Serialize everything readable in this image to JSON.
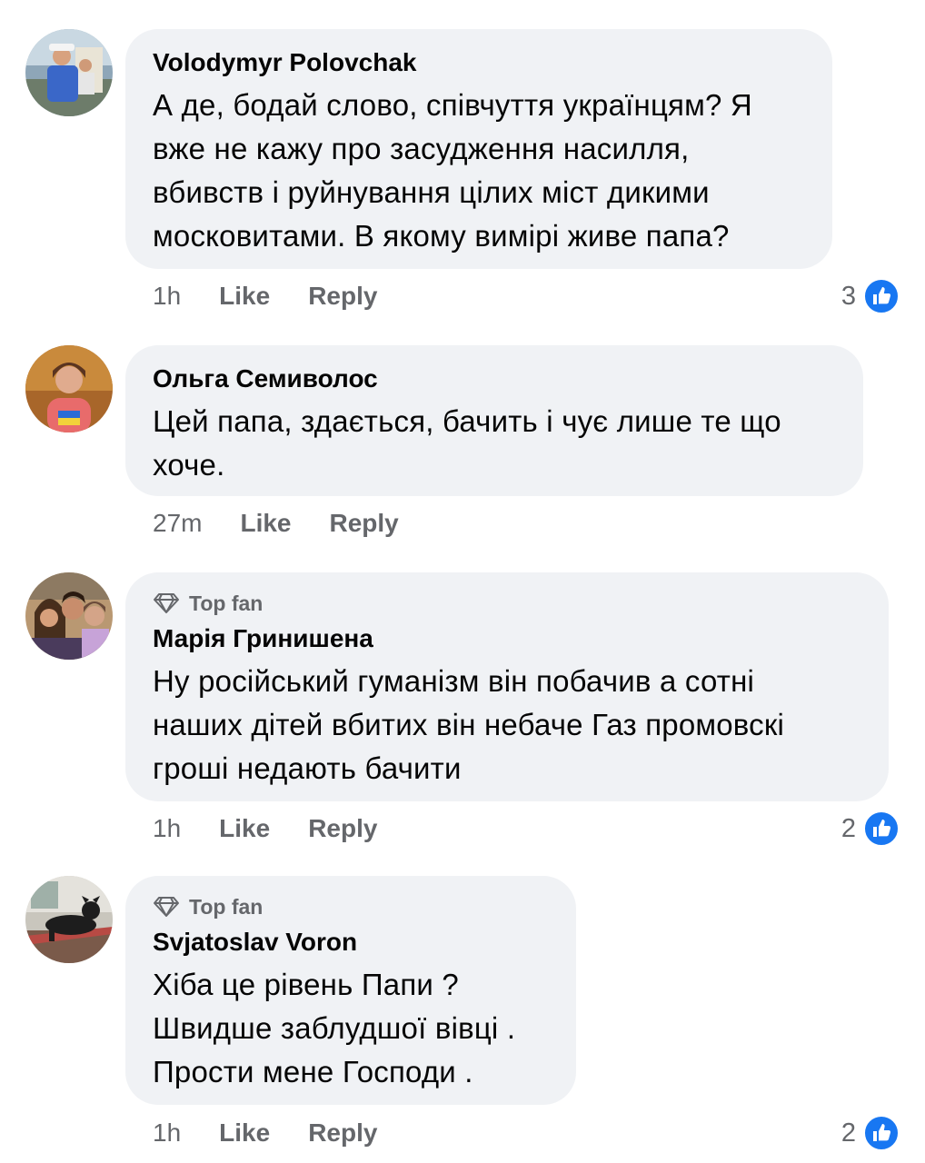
{
  "comments": [
    {
      "author": "Volodymyr Polovchak",
      "top_fan": false,
      "text": "А де, бодай слово, співчуття українцям? Я\nвже не кажу про засудження насилля,\nвбивств і руйнування цілих міст дикими\nмосковитами. В якому вимірі живе папа?",
      "time": "1h",
      "like_label": "Like",
      "reply_label": "Reply",
      "reactions": "3",
      "reaction_icon": "like-icon"
    },
    {
      "author": "Ольга Семиволос",
      "top_fan": false,
      "text": "Цей папа, здається, бачить і чує лише те що\nхоче.",
      "time": "27m",
      "like_label": "Like",
      "reply_label": "Reply",
      "reactions": ""
    },
    {
      "author": "Марія Гринишена",
      "top_fan": true,
      "badge_label": "Top fan",
      "badge_icon": "diamond-icon",
      "text": "Ну російський  гуманізм він побачив  а сотні\nнаших дітей вбитих він небаче  Газ промовскі\nгроші недають бачити",
      "time": "1h",
      "like_label": "Like",
      "reply_label": "Reply",
      "reactions": "2",
      "reaction_icon": "like-icon"
    },
    {
      "author": "Svjatoslav Voron",
      "top_fan": true,
      "badge_label": "Top fan",
      "badge_icon": "diamond-icon",
      "text": "Хіба це рівень Папи ?\nШвидше заблудшої вівці .\nПрости мене Господи .",
      "time": "1h",
      "like_label": "Like",
      "reply_label": "Reply",
      "reactions": "2",
      "reaction_icon": "like-icon"
    }
  ],
  "colors": {
    "bubble": "#f0f2f5",
    "muted_text": "#65676b",
    "like_blue": "#1877f2"
  }
}
